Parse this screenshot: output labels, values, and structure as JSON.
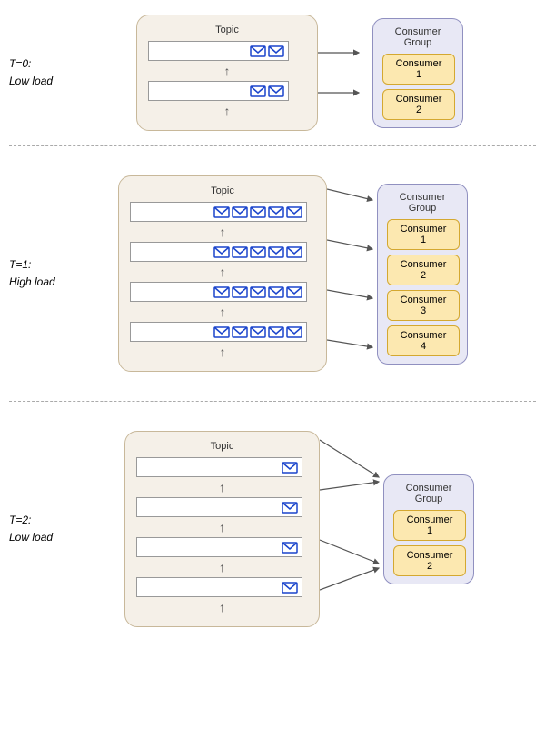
{
  "sections": [
    {
      "id": "s1",
      "time_label_line1": "T=0:",
      "time_label_line2": "Low load",
      "topic_label": "Topic",
      "partitions": [
        {
          "emails": 2
        },
        {
          "emails": 2
        }
      ],
      "consumer_group_label": "Consumer Group",
      "consumers": [
        "Consumer 1",
        "Consumer 2"
      ]
    },
    {
      "id": "s2",
      "time_label_line1": "T=1:",
      "time_label_line2": "High load",
      "topic_label": "Topic",
      "partitions": [
        {
          "emails": 5
        },
        {
          "emails": 5
        },
        {
          "emails": 5
        },
        {
          "emails": 5
        }
      ],
      "consumer_group_label": "Consumer Group",
      "consumers": [
        "Consumer 1",
        "Consumer 2",
        "Consumer 3",
        "Consumer 4"
      ]
    },
    {
      "id": "s3",
      "time_label_line1": "T=2:",
      "time_label_line2": "Low load",
      "topic_label": "Topic",
      "partitions": [
        {
          "emails": 1
        },
        {
          "emails": 1
        },
        {
          "emails": 1
        },
        {
          "emails": 1
        }
      ],
      "consumer_group_label": "Consumer Group",
      "consumers": [
        "Consumer 1",
        "Consumer 2"
      ]
    }
  ]
}
